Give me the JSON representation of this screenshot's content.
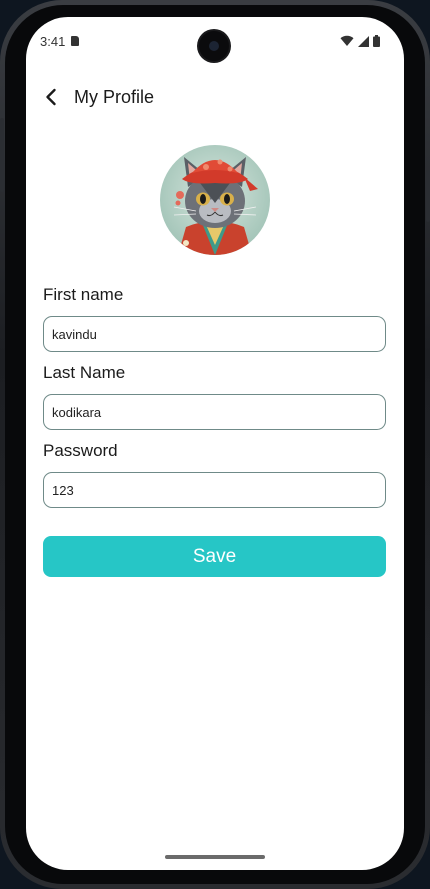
{
  "status_bar": {
    "time": "3:41",
    "icons": [
      "sd-card-icon",
      "wifi-icon",
      "signal-icon",
      "battery-icon"
    ]
  },
  "header": {
    "back_icon": "chevron-left-icon",
    "title": "My Profile"
  },
  "avatar": {
    "description": "cat-avatar-icon"
  },
  "form": {
    "first_name": {
      "label": "First name",
      "value": "kavindu"
    },
    "last_name": {
      "label": "Last Name",
      "value": "kodikara"
    },
    "password": {
      "label": "Password",
      "value": "123"
    }
  },
  "actions": {
    "save_label": "Save"
  },
  "colors": {
    "accent": "#26c6c6",
    "field_border": "#6f8a88",
    "text": "#1b1b1b"
  }
}
